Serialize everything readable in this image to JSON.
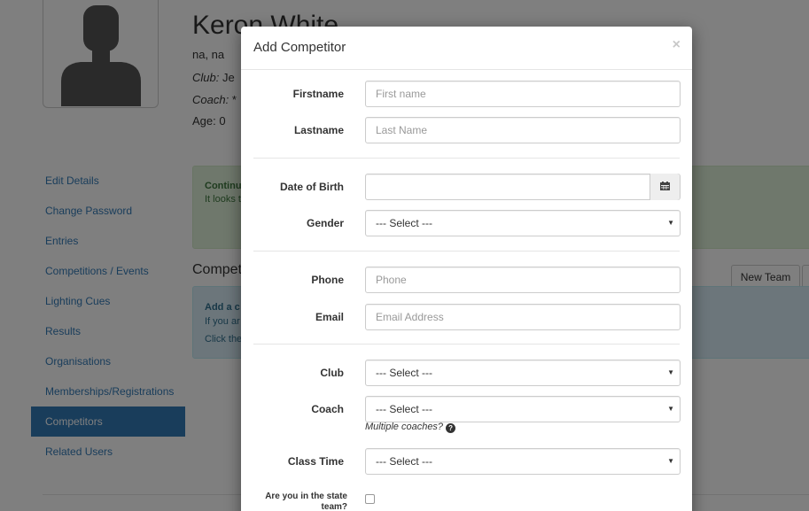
{
  "profile": {
    "name": "Keron White",
    "location": "na, na",
    "club_prefix": "Club:",
    "club_value": "Je",
    "coach_prefix": "Coach:",
    "coach_value": "*",
    "age": "Age: 0"
  },
  "sidebar": {
    "items": [
      {
        "label": "Edit Details"
      },
      {
        "label": "Change Password"
      },
      {
        "label": "Entries"
      },
      {
        "label": "Competitions / Events"
      },
      {
        "label": "Lighting Cues"
      },
      {
        "label": "Results"
      },
      {
        "label": "Organisations"
      },
      {
        "label": "Memberships/Registrations"
      },
      {
        "label": "Competitors",
        "active": true
      },
      {
        "label": "Related Users"
      }
    ]
  },
  "alert_success": {
    "title": "Continu",
    "text": "It looks t"
  },
  "competitors_section": {
    "title": "Competi",
    "new_team_label": "New Team"
  },
  "alert_info": {
    "title": "Add a c",
    "line1": "If you ar",
    "line2": "Click the"
  },
  "modal": {
    "title": "Add Competitor",
    "close_glyph": "×",
    "fields": {
      "firstname": {
        "label": "Firstname",
        "placeholder": "First name"
      },
      "lastname": {
        "label": "Lastname",
        "placeholder": "Last Name"
      },
      "dob": {
        "label": "Date of Birth",
        "value": ""
      },
      "gender": {
        "label": "Gender",
        "value": "--- Select ---"
      },
      "phone": {
        "label": "Phone",
        "placeholder": "Phone"
      },
      "email": {
        "label": "Email",
        "placeholder": "Email Address"
      },
      "club": {
        "label": "Club",
        "value": "--- Select ---"
      },
      "coach": {
        "label": "Coach",
        "value": "--- Select ---",
        "help": "Multiple coaches?"
      },
      "class_time": {
        "label": "Class Time",
        "value": "--- Select ---"
      },
      "state_team": {
        "label": "Are you in the state team?",
        "checked": false
      }
    },
    "caret_glyph": "▼",
    "help_glyph": "?"
  },
  "colors": {
    "primary": "#337ab7",
    "success_bg": "#dff0d8",
    "info_bg": "#d9edf7"
  },
  "icons": [
    "avatar-silhouette-icon",
    "calendar-icon",
    "question-circle-icon",
    "close-icon",
    "caret-down-icon"
  ]
}
